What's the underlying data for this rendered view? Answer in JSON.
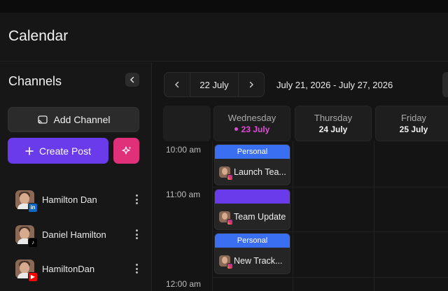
{
  "page": {
    "title": "Calendar"
  },
  "sidebar": {
    "title": "Channels",
    "add_channel_label": "Add Channel",
    "create_post_label": "Create Post",
    "channels": [
      {
        "name": "Hamilton Dan",
        "network": "linkedin",
        "badge_text": "in",
        "badge_color": "#0a66c2"
      },
      {
        "name": "Daniel Hamilton",
        "network": "tiktok",
        "badge_text": "♪",
        "badge_color": "#000000"
      },
      {
        "name": "HamiltonDan",
        "network": "youtube",
        "badge_text": "▶",
        "badge_color": "#ff0000"
      }
    ]
  },
  "toolbar": {
    "current_date": "22 July",
    "date_range": "July 21, 2026 - July 27, 2026"
  },
  "days": [
    {
      "name": "Wednesday",
      "date": "23 July",
      "today": true
    },
    {
      "name": "Thursday",
      "date": "24 July",
      "today": false
    },
    {
      "name": "Friday",
      "date": "25 July",
      "today": false
    }
  ],
  "time_slots": [
    "10:00 am",
    "11:00 am",
    "12:00 am"
  ],
  "events": [
    {
      "tag": "Personal",
      "tag_color": "#3b6ff2",
      "title": "Launch Tea..."
    },
    {
      "tag": "",
      "tag_color": "#6a3bea",
      "title": "Team Update"
    },
    {
      "tag": "Personal",
      "tag_color": "#3b6ff2",
      "title": "New Track..."
    }
  ],
  "colors": {
    "accent_purple": "#6a3bea",
    "accent_pink": "#e0307a",
    "today": "#e14bd9",
    "personal_tag": "#3b6ff2"
  }
}
